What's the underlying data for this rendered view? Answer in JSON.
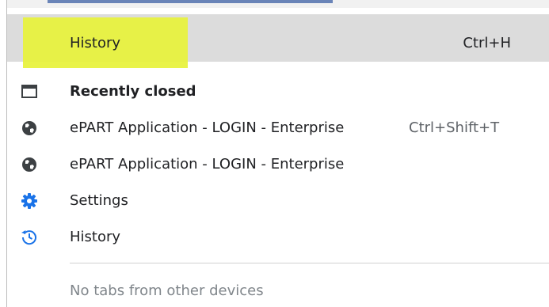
{
  "history_item": {
    "label": "History",
    "shortcut": "Ctrl+H"
  },
  "recently_closed": {
    "title": "Recently closed",
    "items": [
      {
        "label": "ePART Application - LOGIN - Enterprise",
        "shortcut": "Ctrl+Shift+T",
        "icon": "globe-icon"
      },
      {
        "label": "ePART Application - LOGIN - Enterprise",
        "shortcut": "",
        "icon": "globe-icon"
      }
    ]
  },
  "links": {
    "settings": "Settings",
    "history": "History"
  },
  "footer": {
    "no_tabs": "No tabs from other devices"
  },
  "colors": {
    "highlight": "#e7f23a",
    "hover_row": "#dcdcdc",
    "accent_blue": "#1a73e8",
    "icon_dark": "#3c4043"
  }
}
